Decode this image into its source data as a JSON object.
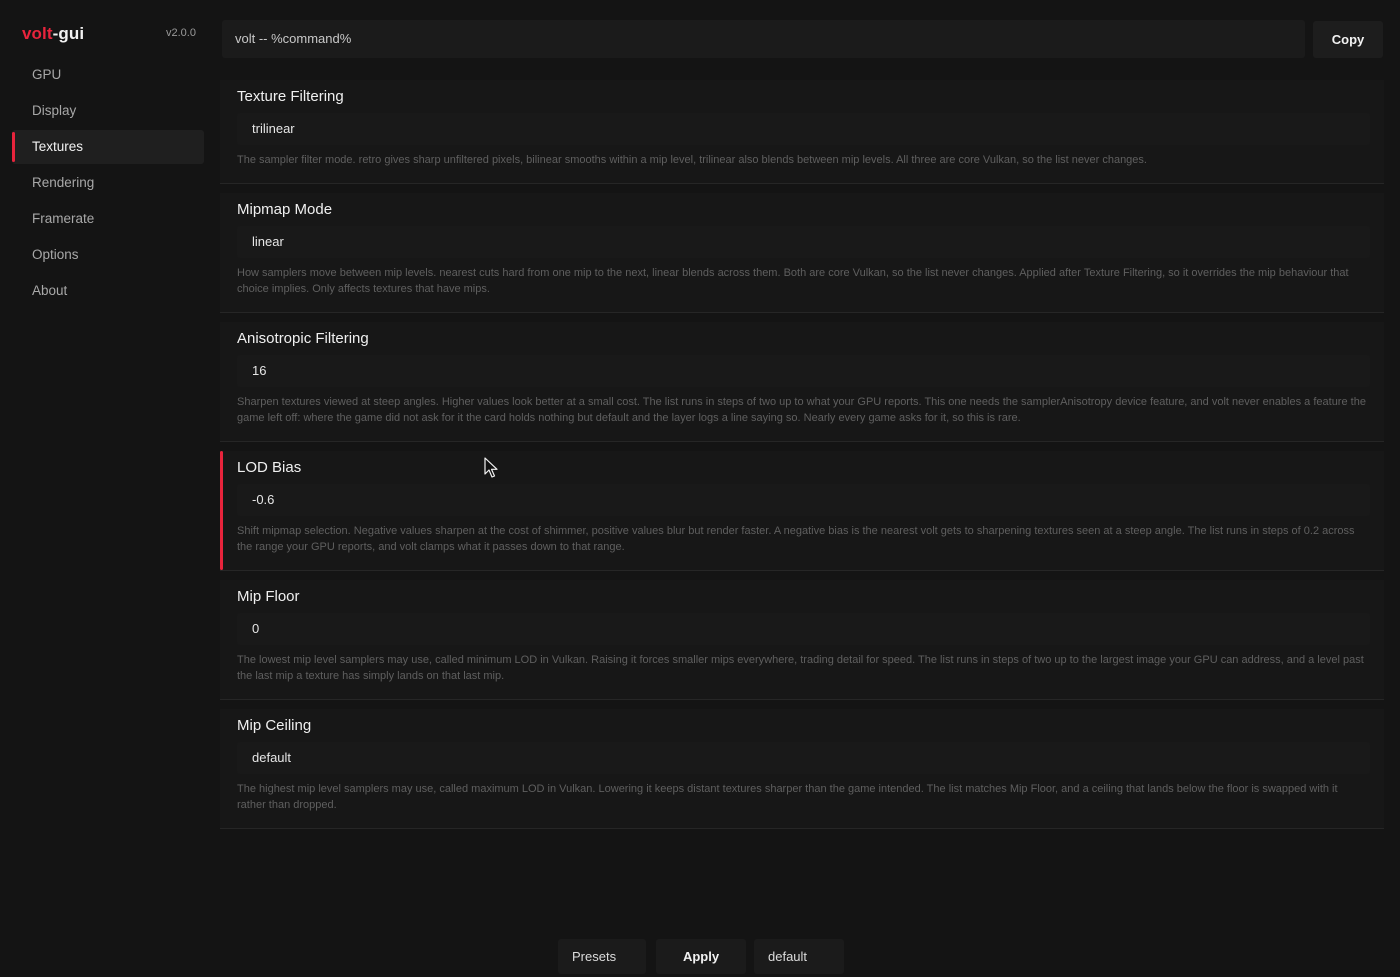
{
  "app": {
    "brand_accent": "volt",
    "brand_rest": "-gui",
    "version": "v2.0.0",
    "accent_color": "#e8243c"
  },
  "sidebar": {
    "items": [
      {
        "label": "GPU"
      },
      {
        "label": "Display"
      },
      {
        "label": "Textures",
        "active": true
      },
      {
        "label": "Rendering"
      },
      {
        "label": "Framerate"
      },
      {
        "label": "Options"
      },
      {
        "label": "About"
      }
    ]
  },
  "command": {
    "value": "volt -- %command%",
    "copy_label": "Copy"
  },
  "settings": [
    {
      "title": "Texture Filtering",
      "value": "trilinear",
      "description": "The sampler filter mode. retro gives sharp unfiltered pixels, bilinear smooths within a mip level, trilinear also blends between mip levels. All three are core Vulkan, so the list never changes."
    },
    {
      "title": "Mipmap Mode",
      "value": "linear",
      "description": "How samplers move between mip levels. nearest cuts hard from one mip to the next, linear blends across them. Both are core Vulkan, so the list never changes. Applied after Texture Filtering, so it overrides the mip behaviour that choice implies. Only affects textures that have mips."
    },
    {
      "title": "Anisotropic Filtering",
      "value": "16",
      "description": "Sharpen textures viewed at steep angles. Higher values look better at a small cost. The list runs in steps of two up to what your GPU reports. This one needs the samplerAnisotropy device feature, and volt never enables a feature the game left off: where the game did not ask for it the card holds nothing but default and the layer logs a line saying so. Nearly every game asks for it, so this is rare."
    },
    {
      "title": "LOD Bias",
      "value": "-0.6",
      "active": true,
      "description": "Shift mipmap selection. Negative values sharpen at the cost of shimmer, positive values blur but render faster. A negative bias is the nearest volt gets to sharpening textures seen at a steep angle. The list runs in steps of 0.2 across the range your GPU reports, and volt clamps what it passes down to that range."
    },
    {
      "title": "Mip Floor",
      "value": "0",
      "description": "The lowest mip level samplers may use, called minimum LOD in Vulkan. Raising it forces smaller mips everywhere, trading detail for speed. The list runs in steps of two up to the largest image your GPU can address, and a level past the last mip a texture has simply lands on that last mip."
    },
    {
      "title": "Mip Ceiling",
      "value": "default",
      "description": "The highest mip level samplers may use, called maximum LOD in Vulkan. Lowering it keeps distant textures sharper than the game intended. The list matches Mip Floor, and a ceiling that lands below the floor is swapped with it rather than dropped."
    }
  ],
  "footer": {
    "presets_label": "Presets",
    "apply_label": "Apply",
    "profile_value": "default"
  }
}
